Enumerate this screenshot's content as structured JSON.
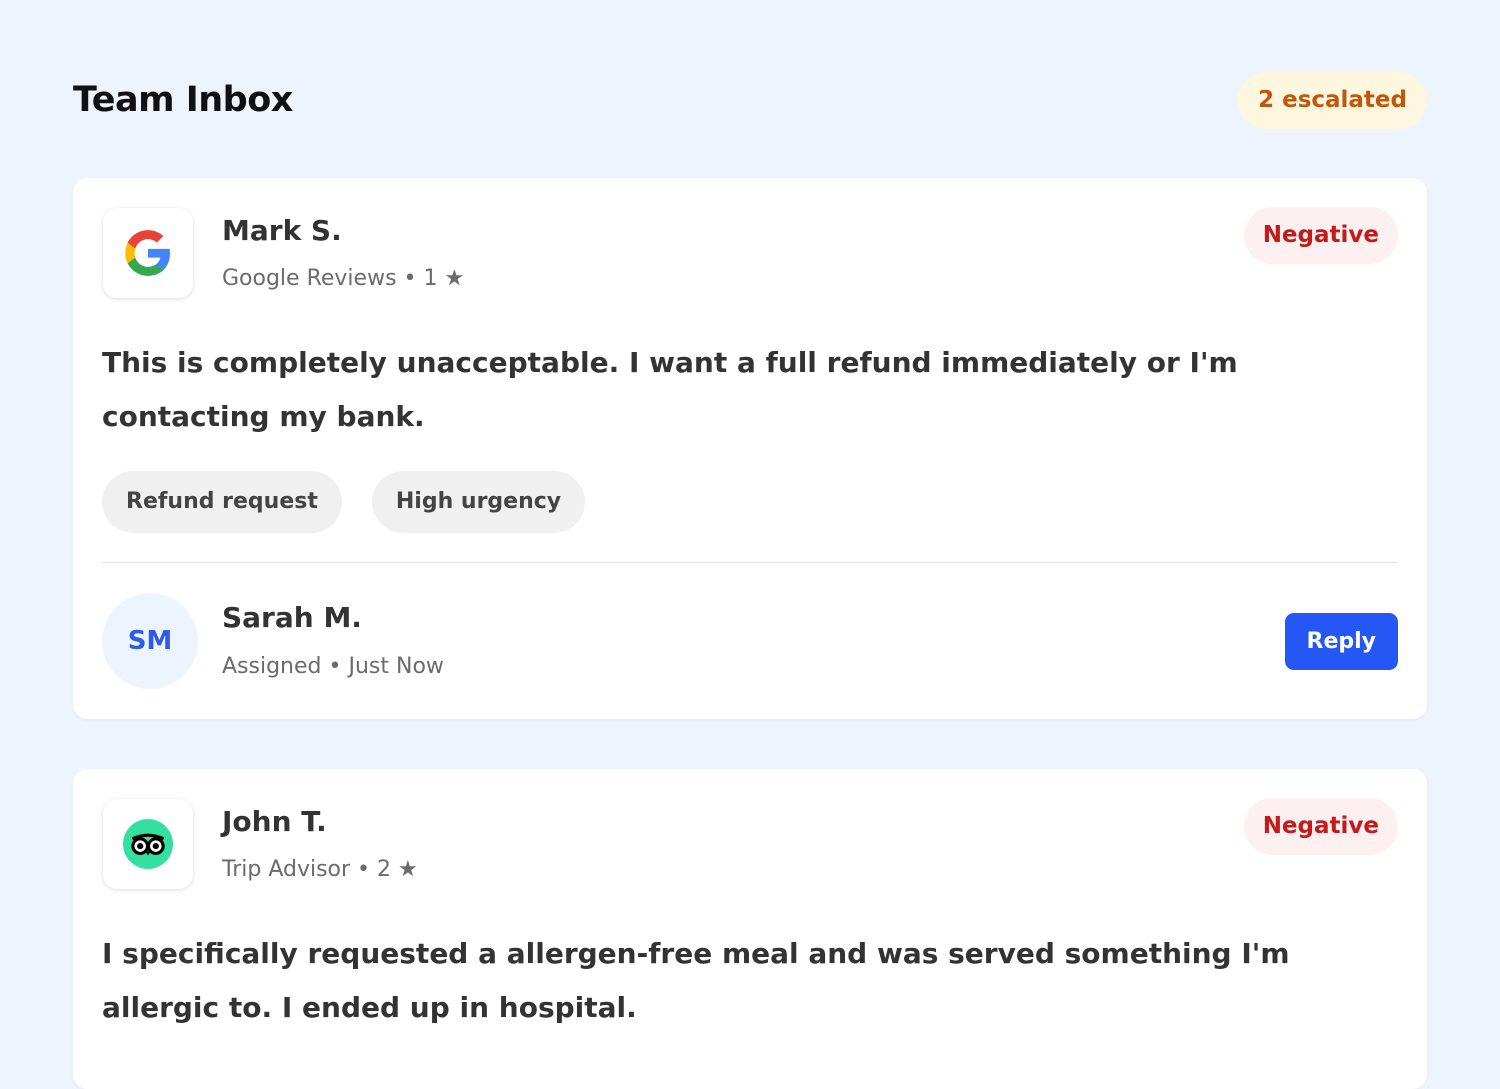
{
  "header": {
    "title": "Team Inbox",
    "escalated_badge": "2 escalated"
  },
  "reviews": [
    {
      "reviewer": "Mark S.",
      "source": "Google Reviews",
      "separator": "•",
      "rating_text": "1 ★",
      "rating": 1,
      "source_icon": "google-logo-icon",
      "sentiment": "Negative",
      "text": "This is completely unacceptable. I want a full refund immediately or I'm contacting my bank.",
      "tags": [
        "Refund request",
        "High urgency"
      ],
      "assignee": {
        "initials": "SM",
        "name": "Sarah M.",
        "status": "Assigned",
        "time": "Just Now"
      },
      "reply_label": "Reply"
    },
    {
      "reviewer": "John T.",
      "source": "Trip Advisor",
      "separator": "•",
      "rating_text": "2 ★",
      "rating": 2,
      "source_icon": "tripadvisor-owl-icon",
      "sentiment": "Negative",
      "text": "I specifically requested a allergen-free meal and was served something I'm allergic to. I ended up in hospital."
    }
  ],
  "colors": {
    "background": "#eef4fe",
    "accent": "#2557f5",
    "negative": "#c41a1a",
    "escalated": "#c2560a",
    "tripadvisor": "#34e0a1"
  }
}
